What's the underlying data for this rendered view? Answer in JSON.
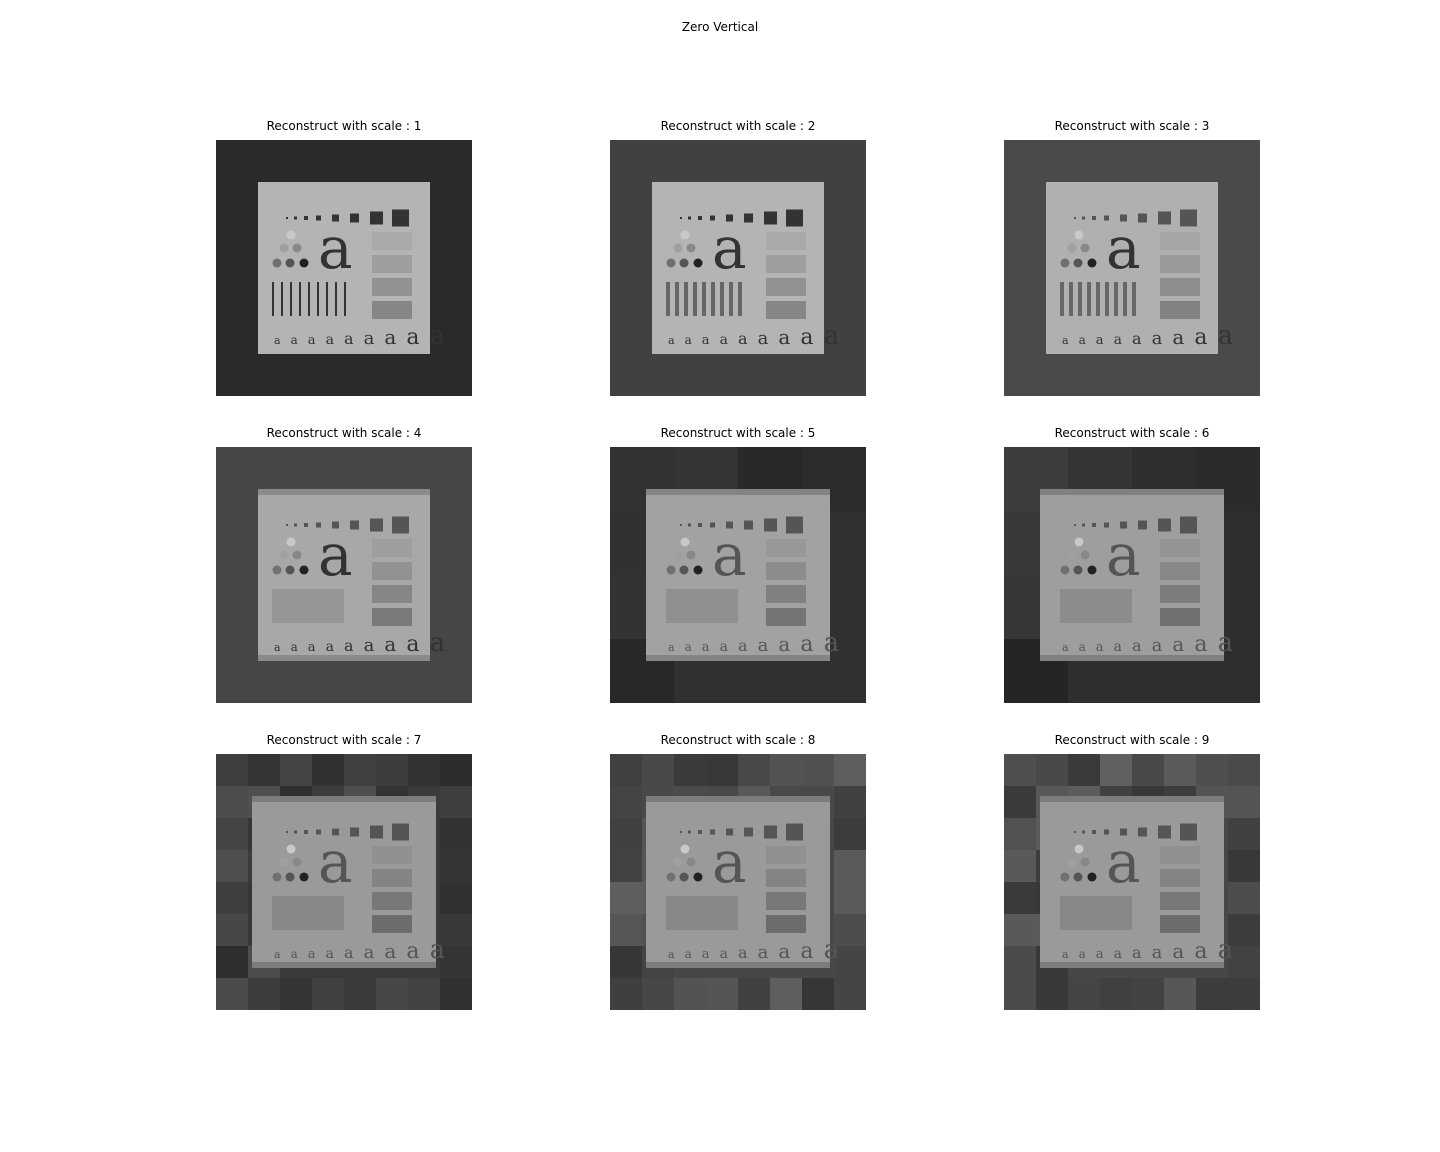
{
  "figure": {
    "title": "Zero Vertical"
  },
  "panels": [
    {
      "title": "Reconstruct with scale : 1",
      "border": "#2a2a2a",
      "inner": "#b4b4b4",
      "blockiness": 0
    },
    {
      "title": "Reconstruct with scale : 2",
      "border": "#414141",
      "inner": "#b4b4b4",
      "blockiness": 1
    },
    {
      "title": "Reconstruct with scale : 3",
      "border": "#4a4a4a",
      "inner": "#b0b0b0",
      "blockiness": 2
    },
    {
      "title": "Reconstruct with scale : 4",
      "border": "#464646",
      "inner": "#a8a8a8",
      "blockiness": 3
    },
    {
      "title": "Reconstruct with scale : 5",
      "border": "#303030",
      "inner": "#a2a2a2",
      "blockiness": 4
    },
    {
      "title": "Reconstruct with scale : 6",
      "border": "#2e2e2e",
      "inner": "#9e9e9e",
      "blockiness": 5
    },
    {
      "title": "Reconstruct with scale : 7",
      "border": "#3a3a3a",
      "inner": "#9a9a9a",
      "blockiness": 6
    },
    {
      "title": "Reconstruct with scale : 8",
      "border": "#474747",
      "inner": "#9a9a9a",
      "blockiness": 7
    },
    {
      "title": "Reconstruct with scale : 9",
      "border": "#474747",
      "inner": "#9a9a9a",
      "blockiness": 7
    }
  ]
}
